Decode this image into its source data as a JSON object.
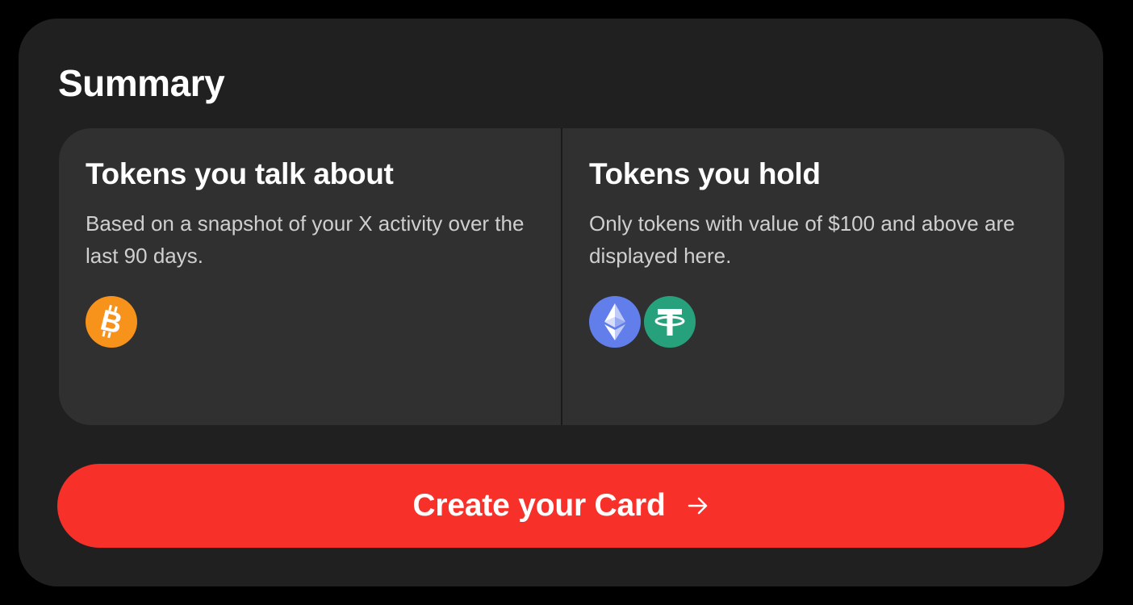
{
  "summary": {
    "title": "Summary"
  },
  "talk_panel": {
    "title": "Tokens you talk about",
    "description": "Based on a snapshot of your X activity over the last 90 days.",
    "tokens": [
      {
        "icon": "bitcoin-icon",
        "color": "#F7931A"
      }
    ]
  },
  "hold_panel": {
    "title": "Tokens you hold",
    "description": "Only tokens with value of $100 and above are displayed here.",
    "tokens": [
      {
        "icon": "ethereum-icon",
        "color": "#627EEA"
      },
      {
        "icon": "tether-icon",
        "color": "#26A17B"
      }
    ]
  },
  "cta": {
    "label": "Create your Card",
    "icon": "arrow-right-icon",
    "color": "#F7302A"
  },
  "colors": {
    "page_background": "#000000",
    "card_background": "#202020",
    "panel_background": "#303030",
    "text_primary": "#FFFFFF",
    "text_secondary": "#CFCFCF"
  }
}
